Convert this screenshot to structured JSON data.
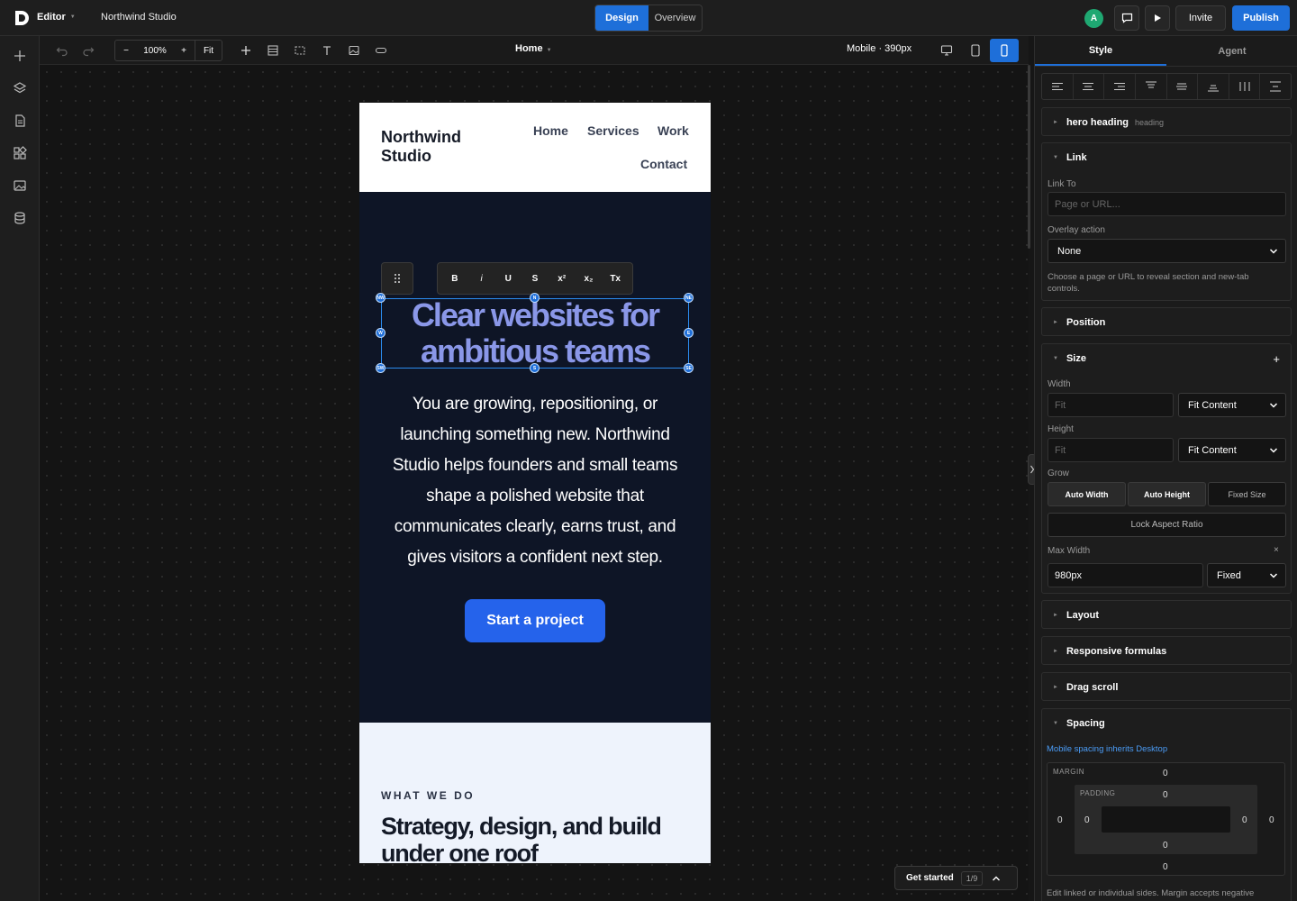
{
  "topbar": {
    "app_label": "Editor",
    "project_name": "Northwind Studio",
    "modes": [
      "Design",
      "Overview"
    ],
    "avatar_letter": "A",
    "invite_label": "Invite",
    "publish_label": "Publish"
  },
  "toolbar": {
    "zoom_minus": "−",
    "zoom_level": "100%",
    "zoom_plus": "+",
    "zoom_fit": "Fit",
    "page_name": "Home",
    "viewport": "Mobile · 390px"
  },
  "site": {
    "brand": "Northwind Studio",
    "nav": [
      "Home",
      "Services",
      "Work",
      "Contact"
    ],
    "hero_heading": "Clear websites for ambitious teams",
    "hero_sub": "You are growing, repositioning, or launching something new. Northwind Studio helps founders and small teams shape a polished website that communicates clearly, earns trust, and gives visitors a confident next step.",
    "cta": "Start a project",
    "eyebrow": "WHAT WE DO",
    "section_heading": "Strategy, design, and build under one roof"
  },
  "format_bar": [
    "B",
    "i",
    "U",
    "S",
    "x²",
    "x₂",
    "Tx"
  ],
  "handles": {
    "nw": "NW",
    "n": "N",
    "ne": "NE",
    "w": "W",
    "e": "E",
    "sw": "SW",
    "s": "S",
    "se": "SE"
  },
  "help": {
    "label": "Get started",
    "count": "1/9"
  },
  "panel": {
    "tabs": [
      "Style",
      "Agent"
    ],
    "element_name": "hero heading",
    "element_type": "heading",
    "link": {
      "title": "Link",
      "link_to_label": "Link To",
      "link_to_placeholder": "Page or URL...",
      "overlay_label": "Overlay action",
      "overlay_value": "None",
      "help": "Choose a page or URL to reveal section and new-tab controls."
    },
    "position_title": "Position",
    "size": {
      "title": "Size",
      "width_label": "Width",
      "width_placeholder": "Fit",
      "width_mode": "Fit Content",
      "height_label": "Height",
      "height_placeholder": "Fit",
      "height_mode": "Fit Content",
      "grow_label": "Grow",
      "grow_options": [
        "Auto Width",
        "Auto Height",
        "Fixed Size"
      ],
      "lock_label": "Lock Aspect Ratio",
      "max_width_label": "Max Width",
      "max_width_value": "980px",
      "max_width_mode": "Fixed"
    },
    "layout_title": "Layout",
    "responsive_title": "Responsive formulas",
    "drag_scroll_title": "Drag scroll",
    "spacing": {
      "title": "Spacing",
      "inherit_note": "Mobile spacing inherits Desktop",
      "margin_label": "MARGIN",
      "padding_label": "PADDING",
      "margin": {
        "top": "0",
        "right": "0",
        "bottom": "0",
        "left": "0"
      },
      "padding": {
        "top": "0",
        "right": "0",
        "bottom": "0",
        "left": "0"
      },
      "footer_note": "Edit linked or individual sides. Margin accepts negative"
    }
  },
  "colors": {
    "accent": "#1e6fd9",
    "hero_bg": "#0e1526",
    "heading": "#8a97e8",
    "cta": "#2563eb",
    "section_bg": "#eef3fc"
  }
}
